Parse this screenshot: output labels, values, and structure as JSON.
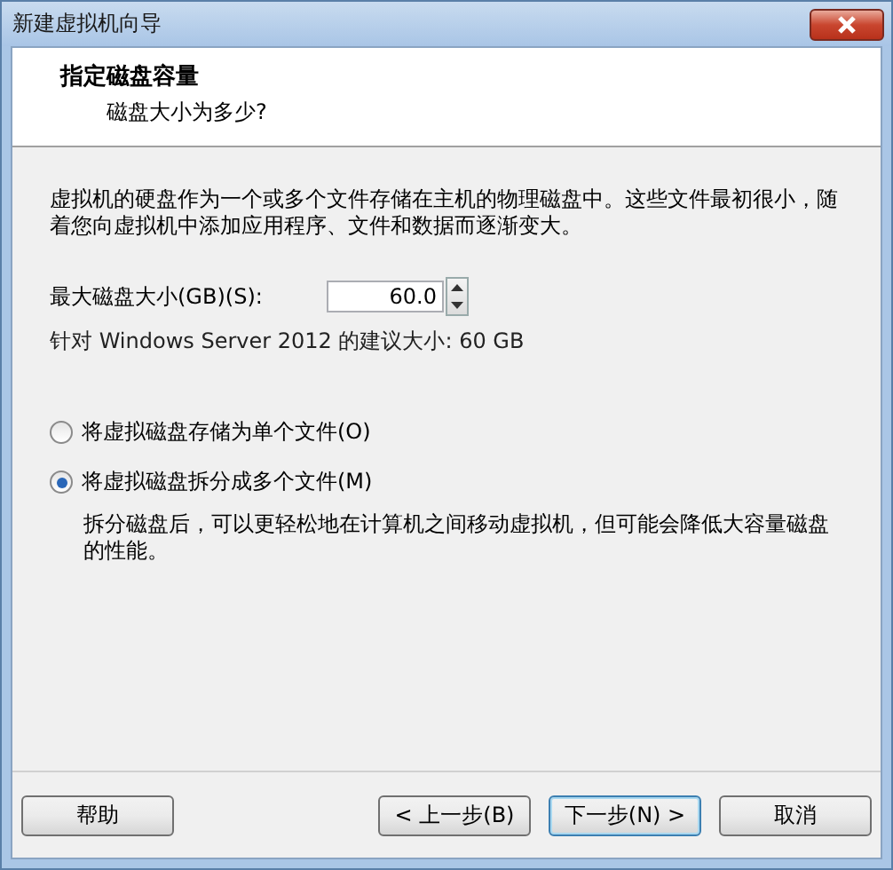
{
  "window": {
    "title": "新建虚拟机向导"
  },
  "header": {
    "title": "指定磁盘容量",
    "subtitle": "磁盘大小为多少?"
  },
  "description": "虚拟机的硬盘作为一个或多个文件存储在主机的物理磁盘中。这些文件最初很小，随着您向虚拟机中添加应用程序、文件和数据而逐渐变大。",
  "disk_size": {
    "label": "最大磁盘大小(GB)(S):",
    "value": "60.0"
  },
  "recommendation": "针对 Windows Server 2012 的建议大小: 60 GB",
  "options": [
    {
      "label": "将虚拟磁盘存储为单个文件(O)",
      "selected": false
    },
    {
      "label": "将虚拟磁盘拆分成多个文件(M)",
      "selected": true,
      "note": "拆分磁盘后，可以更轻松地在计算机之间移动虚拟机，但可能会降低大容量磁盘的性能。"
    }
  ],
  "buttons": [
    {
      "label": "帮助",
      "kind": "help"
    },
    {
      "label": "< 上一步(B)",
      "kind": "nav"
    },
    {
      "label": "下一步(N) >",
      "kind": "default"
    },
    {
      "label": "取消",
      "kind": "nav"
    }
  ]
}
